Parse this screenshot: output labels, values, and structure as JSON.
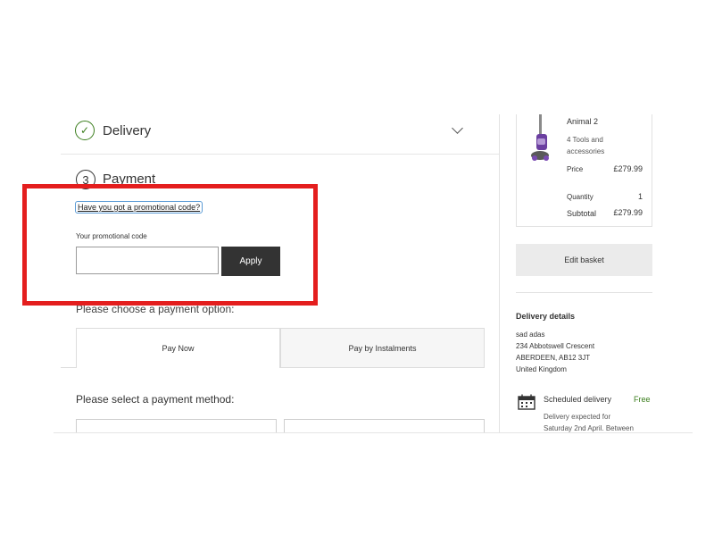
{
  "steps": {
    "delivery": {
      "label": "Delivery"
    },
    "payment": {
      "number": "3",
      "label": "Payment"
    }
  },
  "promo": {
    "link": "Have you got a promotional code?",
    "label": "Your promotional code",
    "input_value": "",
    "input_placeholder": "",
    "apply": "Apply"
  },
  "payment": {
    "choose_prompt": "Please choose a payment option:",
    "tabs": [
      {
        "label": "Pay Now",
        "active": true
      },
      {
        "label": "Pay by Instalments",
        "active": false
      }
    ],
    "select_prompt": "Please select a payment method:"
  },
  "summary": {
    "product_name": "Animal 2",
    "product_sub": "4 Tools and accessories",
    "price_label": "Price",
    "price_value": "£279.99",
    "qty_label": "Quantity",
    "qty_value": "1",
    "subtotal_label": "Subtotal",
    "subtotal_value": "£279.99",
    "edit_basket": "Edit basket"
  },
  "delivery_details": {
    "title": "Delivery details",
    "address_lines": [
      "sad adas",
      "234 Abbotswell Crescent",
      "ABERDEEN, AB12 3JT",
      "United Kingdom"
    ],
    "scheduled_title": "Scheduled delivery",
    "scheduled_price": "Free",
    "expected_line1": "Delivery expected for",
    "expected_line2": "Saturday 2nd April. Between"
  },
  "colors": {
    "accent_green": "#3a7d1c",
    "annotation_red": "#e41e1e",
    "button_dark": "#333333"
  },
  "icons": [
    "check-icon",
    "chevron-down-icon",
    "calendar-icon",
    "product-image"
  ]
}
